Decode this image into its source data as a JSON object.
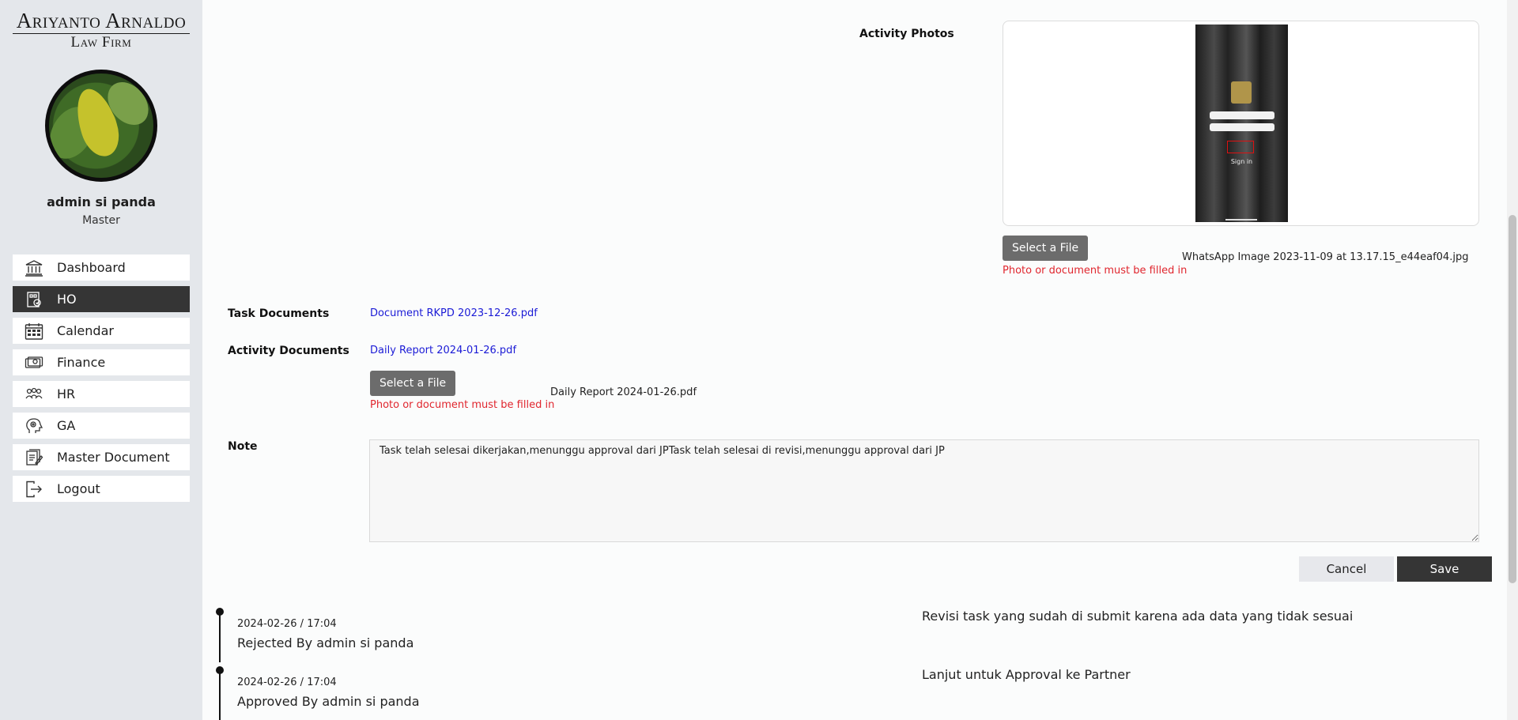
{
  "brand": {
    "line1": "Ariyanto Arnaldo",
    "line2": "Law Firm"
  },
  "user": {
    "name": "admin si panda",
    "role": "Master"
  },
  "menu": {
    "items": [
      {
        "label": "Dashboard",
        "icon": "bank-icon"
      },
      {
        "label": "HO",
        "icon": "office-icon",
        "active": true
      },
      {
        "label": "Calendar",
        "icon": "calendar-icon"
      },
      {
        "label": "Finance",
        "icon": "money-icon"
      },
      {
        "label": "HR",
        "icon": "people-icon"
      },
      {
        "label": "GA",
        "icon": "head-gear-icon"
      },
      {
        "label": "Master Document",
        "icon": "documents-icon"
      },
      {
        "label": "Logout",
        "icon": "logout-icon"
      }
    ]
  },
  "form": {
    "activity_photos_label": "Activity Photos",
    "photo": {
      "phone_text": "Sign in",
      "select_label": "Select a File",
      "file_name": "WhatsApp Image 2023-11-09 at 13.17.15_e44eaf04.jpg",
      "error": "Photo or document must be filled in"
    },
    "task_documents_label": "Task Documents",
    "task_document_link": "Document RKPD 2023-12-26.pdf",
    "activity_documents_label": "Activity Documents",
    "activity_document_link": "Daily Report 2024-01-26.pdf",
    "doc": {
      "select_label": "Select a File",
      "file_name": "Daily Report 2024-01-26.pdf",
      "error": "Photo or document must be filled in"
    },
    "note_label": "Note",
    "note_value": "Task telah selesai dikerjakan,menunggu approval dari JPTask telah selesai di revisi,menunggu approval dari JP",
    "cancel_label": "Cancel",
    "save_label": "Save"
  },
  "timeline": [
    {
      "date": "2024-02-26 / 17:04",
      "status": "Rejected By admin si panda",
      "note": "Revisi task yang sudah di submit karena ada data yang tidak sesuai"
    },
    {
      "date": "2024-02-26 / 17:04",
      "status": "Approved By admin si panda",
      "note": "Lanjut untuk Approval ke Partner"
    }
  ]
}
